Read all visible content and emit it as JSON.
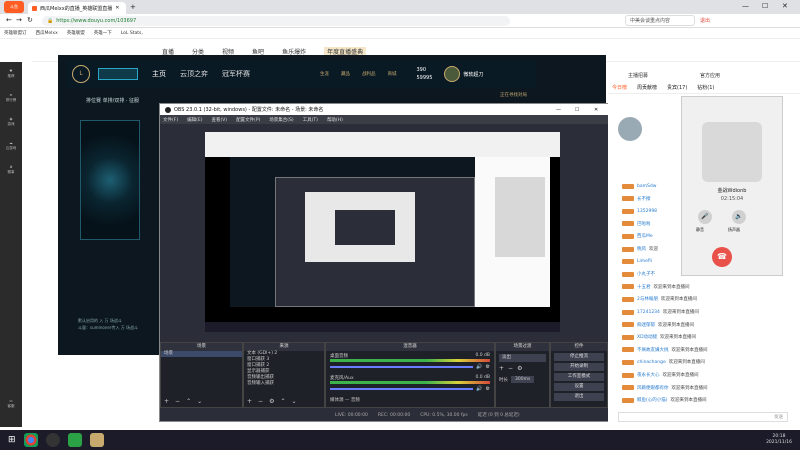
{
  "browser": {
    "tab_title": "西瓜Melxx的直播_英雄联盟直播",
    "url": "https://www.douyu.com/103697",
    "search_hint": "中美会谈重点内容",
    "user_tag": "退出",
    "bookmarks": [
      "英雄联盟订",
      "西瓜Melxx",
      "英雄联盟",
      "英雄一下",
      "LoL Stats, "
    ]
  },
  "site_nav": [
    "直播",
    "分类",
    "视频",
    "鱼吧",
    "鱼乐爆炸",
    "年度直播盛典"
  ],
  "left_rail": [
    "推荐",
    "排行榜",
    "游戏",
    "云游戏",
    "赛事",
    "客服"
  ],
  "lol_client": {
    "nav": [
      "主页",
      "云顶之弈",
      "冠军杯赛"
    ],
    "icons": [
      "生涯",
      "藏品",
      "战利品",
      "商城"
    ],
    "currency": [
      "390",
      "59995"
    ],
    "username": "微软超刀",
    "status": "正在寻找对局",
    "mode_label": "排位赛 单排/双排 · 征服",
    "foot_text1": "默认启用的 入 万 场战斗",
    "foot_text2": "斗量：summoner传入 万 场战斗"
  },
  "obs": {
    "title": "OBS 23.0.1 (32-bit, windows) - 配置文件: 未命名 - 场景: 未命名",
    "menu": [
      "文件(F)",
      "编辑(E)",
      "查看(V)",
      "配置文件(P)",
      "场景集合(S)",
      "工具(T)",
      "帮助(H)"
    ],
    "docks": {
      "scenes": "场景",
      "sources": "来源",
      "mixer": "混音器",
      "transitions": "场景过渡",
      "controls": "控件"
    },
    "scene_item": "场景",
    "sources": [
      "文本 (GDI+) 2",
      "窗口捕获 3",
      "窗口捕获 2",
      "显示器捕获",
      "音频输出捕获",
      "音频输入捕获"
    ],
    "mixer_tracks": [
      {
        "label": "桌面音频",
        "db": "0.0 dB"
      },
      {
        "label": "麦克风/Aux",
        "db": "0.0 dB"
      },
      {
        "label": "媒体源 — 音频",
        "db": ""
      }
    ],
    "transition": {
      "type": "淡出",
      "duration_label": "时长",
      "duration": "300ms"
    },
    "controls": [
      "停止推流",
      "开始录制",
      "工作室模式",
      "设置",
      "退出"
    ],
    "status": [
      "LIVE: 00:00:00",
      "REC: 00:00:00",
      "CPU: 0.5%, 30.00 fps"
    ],
    "status_right": "延迟 (0 到 0 总延迟)"
  },
  "chat": {
    "tabs": [
      "今日榜",
      "周贡献榜",
      "贵宾(17)",
      "钻粉(1)"
    ],
    "top_label": "主播招募",
    "rank_label": "官方应用",
    "messages": [
      {
        "name": "bamSdw",
        "text": ""
      },
      {
        "name": "长不擦",
        "text": ""
      },
      {
        "name": "1352998",
        "text": ""
      },
      {
        "name": "巴啦啦",
        "text": ""
      },
      {
        "name": "西瓜Me",
        "text": ""
      },
      {
        "name": "晚风",
        "text": "欢迎"
      },
      {
        "name": "Limefli",
        "text": ""
      },
      {
        "name": "小丸子不",
        "text": ""
      },
      {
        "name": "十五君",
        "text": "欢迎来到本直播间"
      },
      {
        "name": "2与林翰朋",
        "text": "欢迎来到本直播间"
      },
      {
        "name": "17241234",
        "text": "欢迎来到本直播间"
      },
      {
        "name": "痴迷郁郁",
        "text": "欢迎来到本直播间"
      },
      {
        "name": "XD动动腿",
        "text": "欢迎来到本直播间"
      },
      {
        "name": "不屑故友嫌大挑",
        "text": "欢迎来到本直播间"
      },
      {
        "name": "chinachange",
        "text": "欢迎来到本直播间"
      },
      {
        "name": "夜永长大心",
        "text": "欢迎来到本直播间"
      },
      {
        "name": "风蕲便跟都有你",
        "text": "欢迎来到本直播间"
      },
      {
        "name": "鲸鱼(心的小猫)",
        "text": "欢迎来到本直播间"
      }
    ],
    "input_hint": "发送"
  },
  "call": {
    "name": "金战Wdionb",
    "time": "02:15:04",
    "actions": [
      "静音",
      "扬声器"
    ]
  },
  "taskbar": {
    "time": "20:18",
    "date": "2021/11/16"
  },
  "colors": {
    "accent": "#ff5d23",
    "lol_gold": "#c8aa6e",
    "obs_bg": "#2b2e38",
    "hangup": "#e8524a"
  }
}
